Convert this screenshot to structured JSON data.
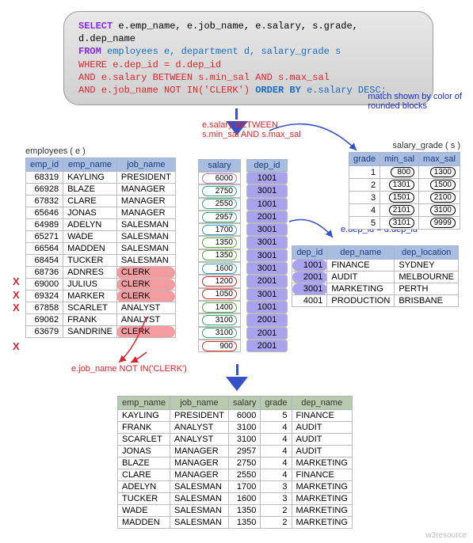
{
  "sql": {
    "select": "SELECT",
    "cols": "e.emp_name, e.job_name, e.salary, s.grade, d.dep_name",
    "from": "FROM",
    "tables": "employees e, department d, salary_grade s",
    "where": "WHERE",
    "c1": "e.dep_id = d.dep_id",
    "and1": "AND",
    "c2": "e.salary BETWEEN s.min_sal AND s.max_sal",
    "and2": "AND",
    "c3": "e.job_name NOT IN('CLERK')",
    "orderby": "ORDER BY",
    "ordercol": "e.salary DESC;"
  },
  "notes": {
    "match": "match shown by color of\nrounded blocks",
    "between": "e.salary BETWEEN\ns.min_sal AND s.max_sal",
    "join": "e.dep_id = d.dep_id",
    "notin": "e.job_name NOT IN('CLERK')"
  },
  "emp_title": "employees ( e )",
  "emp_cols": [
    "emp_id",
    "emp_name",
    "job_name"
  ],
  "emp_rows": [
    {
      "id": 68319,
      "name": "KAYLING",
      "job": "PRESIDENT",
      "sal": 6000,
      "dep": 1001,
      "g": 5,
      "clerk": false
    },
    {
      "id": 66928,
      "name": "BLAZE",
      "job": "MANAGER",
      "sal": 2750,
      "dep": 3001,
      "g": 4,
      "clerk": false
    },
    {
      "id": 67832,
      "name": "CLARE",
      "job": "MANAGER",
      "sal": 2550,
      "dep": 1001,
      "g": 4,
      "clerk": false
    },
    {
      "id": 65646,
      "name": "JONAS",
      "job": "MANAGER",
      "sal": 2957,
      "dep": 2001,
      "g": 4,
      "clerk": false
    },
    {
      "id": 64989,
      "name": "ADELYN",
      "job": "SALESMAN",
      "sal": 1700,
      "dep": 3001,
      "g": 3,
      "clerk": false
    },
    {
      "id": 65271,
      "name": "WADE",
      "job": "SALESMAN",
      "sal": 1350,
      "dep": 3001,
      "g": 2,
      "clerk": false
    },
    {
      "id": 66564,
      "name": "MADDEN",
      "job": "SALESMAN",
      "sal": 1350,
      "dep": 3001,
      "g": 2,
      "clerk": false
    },
    {
      "id": 68454,
      "name": "TUCKER",
      "job": "SALESMAN",
      "sal": 1600,
      "dep": 3001,
      "g": 3,
      "clerk": false
    },
    {
      "id": 68736,
      "name": "ADNRES",
      "job": "CLERK",
      "sal": 1200,
      "dep": 2001,
      "g": 1,
      "clerk": true
    },
    {
      "id": 69000,
      "name": "JULIUS",
      "job": "CLERK",
      "sal": 1050,
      "dep": 3001,
      "g": 1,
      "clerk": true
    },
    {
      "id": 69324,
      "name": "MARKER",
      "job": "CLERK",
      "sal": 1400,
      "dep": 1001,
      "g": 2,
      "clerk": true
    },
    {
      "id": 67858,
      "name": "SCARLET",
      "job": "ANALYST",
      "sal": 3100,
      "dep": 2001,
      "g": 4,
      "clerk": false
    },
    {
      "id": 69062,
      "name": "FRANK",
      "job": "ANALYST",
      "sal": 3100,
      "dep": 2001,
      "g": 4,
      "clerk": false
    },
    {
      "id": 63679,
      "name": "SANDRINE",
      "job": "CLERK",
      "sal": 900,
      "dep": 2001,
      "g": 1,
      "clerk": true
    }
  ],
  "sal_col_head": "salary",
  "dep_col_head": "dep_id",
  "sg_title": "salary_grade ( s )",
  "sg_cols": [
    "grade",
    "min_sal",
    "max_sal"
  ],
  "sg_rows": [
    {
      "grade": 1,
      "min": 800,
      "max": 1300,
      "g": 1
    },
    {
      "grade": 2,
      "min": 1301,
      "max": 1500,
      "g": 2
    },
    {
      "grade": 3,
      "min": 1501,
      "max": 2100,
      "g": 3
    },
    {
      "grade": 4,
      "min": 2101,
      "max": 3100,
      "g": 4
    },
    {
      "grade": 5,
      "min": 3101,
      "max": 9999,
      "g": 5
    }
  ],
  "dep_cols": [
    "dep_id",
    "dep_name",
    "dep_location"
  ],
  "dep_rows": [
    {
      "id": 1001,
      "name": "FINANCE",
      "loc": "SYDNEY",
      "hl": true
    },
    {
      "id": 2001,
      "name": "AUDIT",
      "loc": "MELBOURNE",
      "hl": true
    },
    {
      "id": 3001,
      "name": "MARKETING",
      "loc": "PERTH",
      "hl": true
    },
    {
      "id": 4001,
      "name": "PRODUCTION",
      "loc": "BRISBANE",
      "hl": false
    }
  ],
  "res_cols": [
    "emp_name",
    "job_name",
    "salary",
    "grade",
    "dep_name"
  ],
  "res_rows": [
    [
      "KAYLING",
      "PRESIDENT",
      6000,
      5,
      "FINANCE"
    ],
    [
      "FRANK",
      "ANALYST",
      3100,
      4,
      "AUDIT"
    ],
    [
      "SCARLET",
      "ANALYST",
      3100,
      4,
      "AUDIT"
    ],
    [
      "JONAS",
      "MANAGER",
      2957,
      4,
      "AUDIT"
    ],
    [
      "BLAZE",
      "MANAGER",
      2750,
      4,
      "MARKETING"
    ],
    [
      "CLARE",
      "MANAGER",
      2550,
      4,
      "FINANCE"
    ],
    [
      "ADELYN",
      "SALESMAN",
      1700,
      3,
      "MARKETING"
    ],
    [
      "TUCKER",
      "SALESMAN",
      1600,
      3,
      "MARKETING"
    ],
    [
      "WADE",
      "SALESMAN",
      1350,
      2,
      "MARKETING"
    ],
    [
      "MADDEN",
      "SALESMAN",
      1350,
      2,
      "MARKETING"
    ]
  ],
  "x": "X",
  "watermark": "w3resource"
}
